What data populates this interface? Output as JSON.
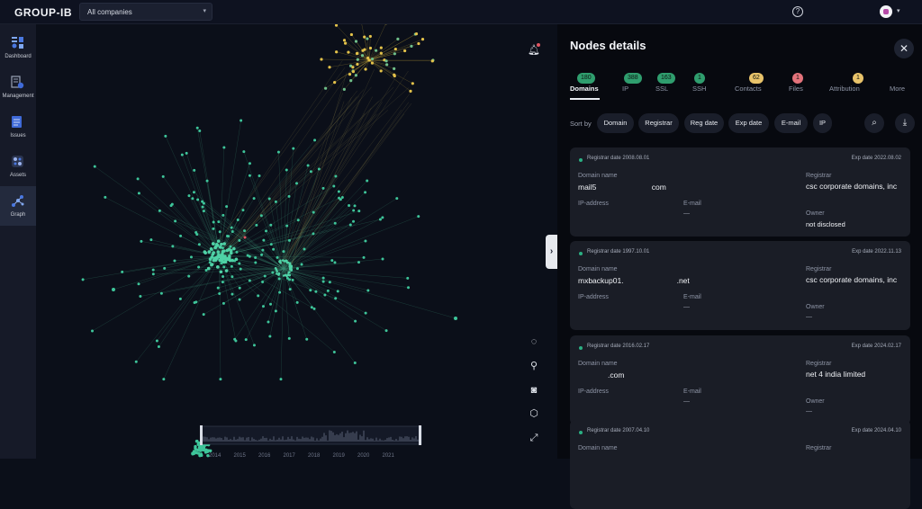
{
  "topbar": {
    "brand": "GROUP-IB",
    "company_select": "All companies"
  },
  "sidebar": {
    "items": [
      {
        "label": "Dashboard",
        "icon": "dashboard-icon"
      },
      {
        "label": "Management",
        "icon": "management-icon"
      },
      {
        "label": "Issues",
        "icon": "issues-icon"
      },
      {
        "label": "Assets",
        "icon": "assets-icon"
      },
      {
        "label": "Graph",
        "icon": "graph-icon"
      }
    ]
  },
  "graph": {
    "timeline_years": [
      "2014",
      "2015",
      "2016",
      "2017",
      "2018",
      "2019",
      "2020",
      "2021"
    ]
  },
  "panel": {
    "title": "Nodes details",
    "tabs": [
      {
        "label": "Domains",
        "count": "180",
        "badge_color": "#2f9e6e"
      },
      {
        "label": "IP",
        "count": "388",
        "badge_color": "#2f9e6e"
      },
      {
        "label": "SSL",
        "count": "163",
        "badge_color": "#2f9e6e"
      },
      {
        "label": "SSH",
        "count": "1",
        "badge_color": "#2f9e6e"
      },
      {
        "label": "Contacts",
        "count": "62",
        "badge_color": "#e8c36a"
      },
      {
        "label": "Files",
        "count": "1",
        "badge_color": "#e3737b"
      },
      {
        "label": "Attribution",
        "count": "1",
        "badge_color": "#e8c36a"
      },
      {
        "label": "More",
        "count": "",
        "badge_color": ""
      }
    ],
    "sort_label": "Sort by",
    "sort_options": [
      "Domain",
      "Registrar",
      "Reg date",
      "Exp date",
      "E-mail",
      "IP"
    ],
    "field_labels": {
      "domain": "Domain name",
      "registrar": "Registrar",
      "ip": "IP-address",
      "email": "E-mail",
      "owner": "Owner",
      "empty": "—"
    },
    "cards": [
      {
        "reg_date": "Registrar date 2008.08.01",
        "exp_date": "Exp date 2022.08.02",
        "domain": "mail5                          com",
        "registrar": "csc corporate domains, inc",
        "owner": "not disclosed"
      },
      {
        "reg_date": "Registrar date 1997.10.01",
        "exp_date": "Exp date 2022.11.13",
        "domain": "mxbackup01.                         .net",
        "registrar": "csc corporate domains, inc",
        "owner": "—"
      },
      {
        "reg_date": "Registrar date 2016.02.17",
        "exp_date": "Exp date 2024.02.17",
        "domain": "              .com",
        "registrar": "net 4 india limited",
        "owner": "—"
      },
      {
        "reg_date": "Registrar date 2007.04.10",
        "exp_date": "Exp date 2024.04.10",
        "domain": "",
        "registrar": "",
        "owner": ""
      }
    ]
  }
}
